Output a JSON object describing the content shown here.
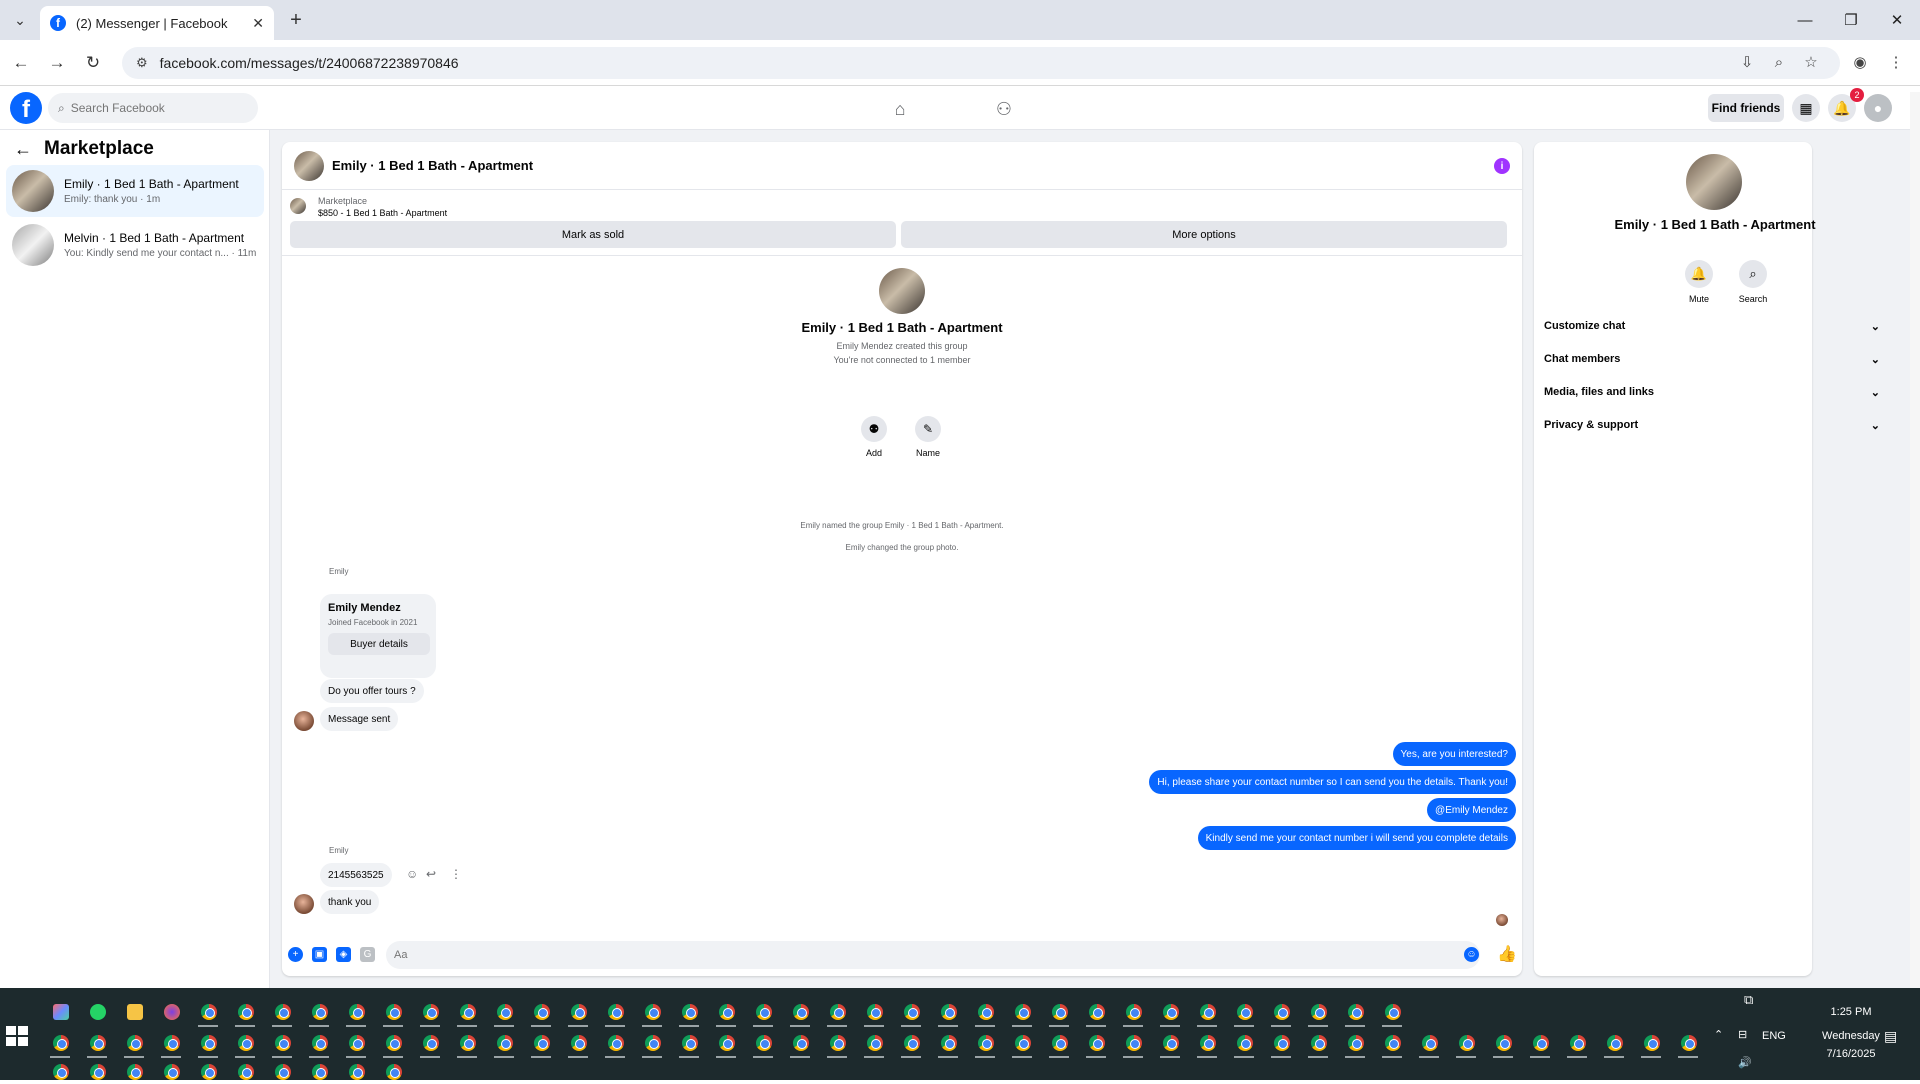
{
  "browser": {
    "tab_title": "(2) Messenger | Facebook",
    "url": "facebook.com/messages/t/24006872238970846"
  },
  "fb_header": {
    "search_placeholder": "Search Facebook",
    "find_friends": "Find friends",
    "notification_count": "2"
  },
  "left": {
    "title": "Marketplace",
    "conversations": [
      {
        "name": "Emily · 1 Bed 1 Bath - Apartment",
        "snippet": "Emily: thank you · 1m"
      },
      {
        "name": "Melvin · 1 Bed 1 Bath - Apartment",
        "snippet": "You: Kindly send me your contact n... · 11m"
      }
    ]
  },
  "chat": {
    "title": "Emily · 1 Bed 1 Bath - Apartment",
    "marketplace_label": "Marketplace",
    "listing": "$850 - 1 Bed 1 Bath - Apartment",
    "mark_sold": "Mark as sold",
    "more_options": "More options",
    "group_name": "Emily · 1 Bed 1 Bath - Apartment",
    "group_created": "Emily Mendez created this group",
    "group_connected": "You're not connected to 1 member",
    "add_label": "Add",
    "name_label": "Name",
    "system_1": "Emily named the group Emily · 1 Bed 1 Bath - Apartment.",
    "system_2": "Emily changed the group photo.",
    "sender_name": "Emily",
    "card_name": "Emily Mendez",
    "card_sub": "Joined Facebook in 2021",
    "card_button": "Buyer details",
    "in_1": "Do you offer tours ?",
    "in_2": "Message sent",
    "out_1": "Yes, are you interested?",
    "out_2": "Hi, please share your contact number so I can send you the details. Thank you!",
    "out_3": "@Emily Mendez",
    "out_4": "Kindly send me your contact number i will send you complete details",
    "in_3": "2145563525",
    "in_4": "thank you",
    "composer_placeholder": "Aa"
  },
  "right": {
    "name": "Emily · 1 Bed 1 Bath - Apartment",
    "mute": "Mute",
    "search": "Search",
    "sections": [
      "Customize chat",
      "Chat members",
      "Media, files and links",
      "Privacy & support"
    ]
  },
  "taskbar": {
    "time": "1:25 PM",
    "day": "Wednesday",
    "date": "7/16/2025",
    "lang": "ENG"
  }
}
